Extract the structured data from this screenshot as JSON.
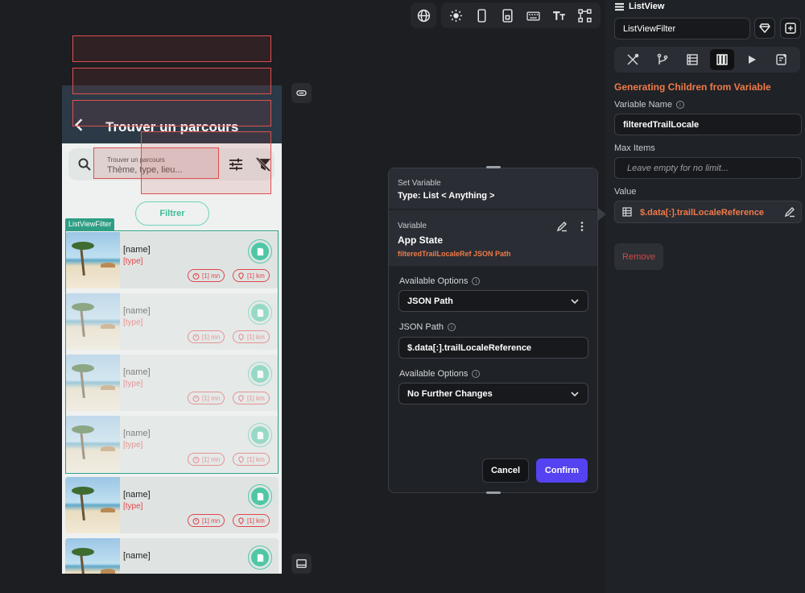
{
  "toolbar": {
    "icons": [
      "globe-icon",
      "sun-icon",
      "phone-icon",
      "tablet-icon",
      "keyboard-icon",
      "text-size-icon",
      "layout-icon"
    ]
  },
  "phone": {
    "title": "Trouver un parcours",
    "search": {
      "label": "Trouver un parcours",
      "placeholder": "Thème, type, lieu..."
    },
    "filter_button": "Filtrer",
    "listview_tag": "ListViewFilter",
    "cards": [
      {
        "name": "[name]",
        "type": "[type]",
        "duration": "[1] mn",
        "distance": "[1] km"
      },
      {
        "name": "[name]",
        "type": "[type]",
        "duration": "[1] mn",
        "distance": "[1] km"
      },
      {
        "name": "[name]",
        "type": "[type]",
        "duration": "[1] mn",
        "distance": "[1] km"
      },
      {
        "name": "[name]",
        "type": "[type]",
        "duration": "[1] mn",
        "distance": "[1] km"
      },
      {
        "name": "[name]",
        "type": "[type]",
        "duration": "[1] mn",
        "distance": "[1] km"
      },
      {
        "name": "[name]",
        "type": "",
        "duration": "",
        "distance": ""
      }
    ]
  },
  "dialog": {
    "header_label": "Set Variable",
    "header_type": "Type: List < Anything >",
    "variable_label": "Variable",
    "variable_value": "App State",
    "variable_sub": "filteredTrailLocaleRef JSON Path",
    "available_options_label": "Available Options",
    "available_options_value": "JSON Path",
    "json_path_label": "JSON Path",
    "json_path_value": "$.data[:].trailLocaleReference",
    "available_options2_label": "Available Options",
    "available_options2_value": "No Further Changes",
    "cancel": "Cancel",
    "confirm": "Confirm"
  },
  "panel": {
    "title": "ListView",
    "name_field": "ListViewFilter",
    "section_title": "Generating Children from Variable",
    "variable_name_label": "Variable Name",
    "variable_name_value": "filteredTrailLocale",
    "max_items_label": "Max Items",
    "max_items_placeholder": "Leave empty for no limit...",
    "value_label": "Value",
    "value_text": "$.data[:].trailLocaleReference",
    "remove": "Remove"
  },
  "colors": {
    "accent_orange": "#f07a4a",
    "confirm_purple": "#5542f0",
    "teal": "#2e9e84",
    "red": "#e0464a"
  }
}
